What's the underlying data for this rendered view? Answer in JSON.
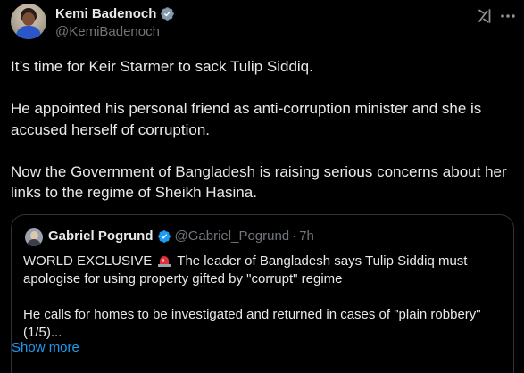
{
  "author": {
    "display_name": "Kemi Badenoch",
    "handle": "@KemiBadenoch"
  },
  "tweet": {
    "paragraphs": [
      "It’s time for Keir Starmer to sack Tulip Siddiq.",
      "He appointed his personal friend as anti-corruption minister and she is accused herself of corruption.",
      "Now the Government of Bangladesh is raising serious concerns about her links to the regime of Sheikh Hasina."
    ]
  },
  "quote": {
    "display_name": "Gabriel Pogrund",
    "handle": "@Gabriel_Pogrund",
    "separator": "·",
    "time": "7h",
    "text_before_emoji": "WORLD EXCLUSIVE",
    "text_after_emoji": "The leader of Bangladesh says Tulip Siddiq must apologise for using property gifted by \"corrupt\" regime",
    "paragraph2": "He calls for homes to be investigated and returned in cases of  \"plain robbery\" (1/5)...",
    "show_more_label": "Show more"
  },
  "icons": {
    "verified": "verified-badge-icon",
    "grok": "grok-icon",
    "more": "more-options-icon",
    "siren": "siren-emoji-icon"
  },
  "colors": {
    "background": "#000000",
    "text": "#e7e9ea",
    "muted": "#71767b",
    "link": "#1d9bf0",
    "border": "#2f3336"
  }
}
